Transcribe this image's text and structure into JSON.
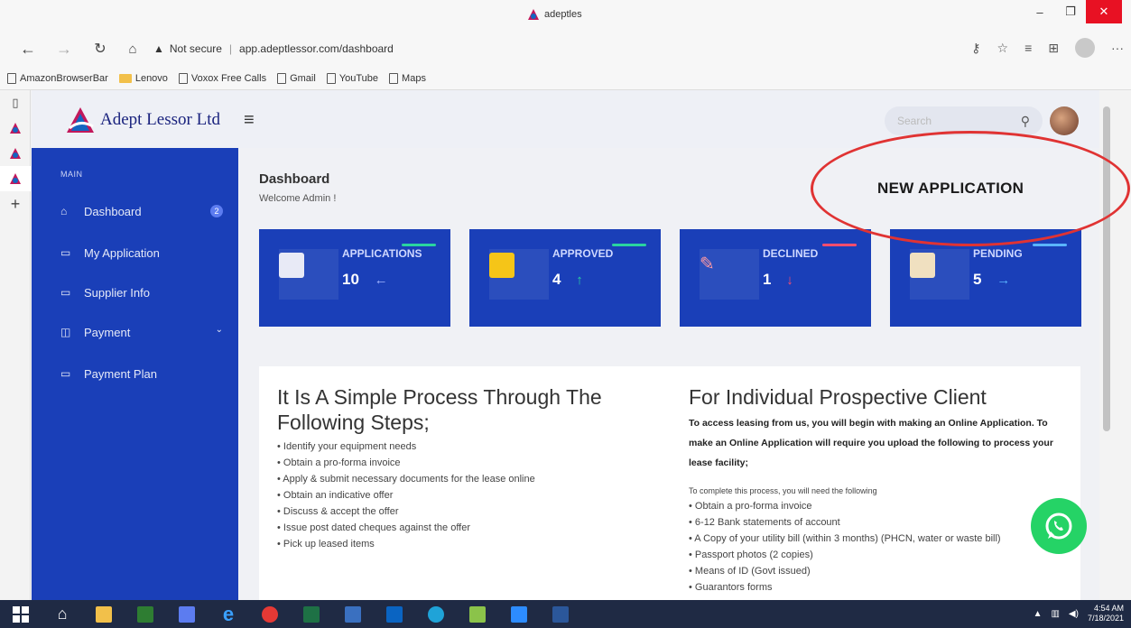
{
  "browser": {
    "tab_title": "adeptles",
    "security_label": "Not secure",
    "url": "app.adeptlessor.com/dashboard",
    "window_controls": [
      "–",
      "❐",
      "✕"
    ],
    "bookmarks": [
      {
        "label": "AmazonBrowserBar",
        "type": "page"
      },
      {
        "label": "Lenovo",
        "type": "folder"
      },
      {
        "label": "Voxox Free Calls",
        "type": "page"
      },
      {
        "label": "Gmail",
        "type": "page"
      },
      {
        "label": "YouTube",
        "type": "page"
      },
      {
        "label": "Maps",
        "type": "page"
      }
    ]
  },
  "header": {
    "brand": "Adept Lessor Ltd",
    "search_placeholder": "Search"
  },
  "sidebar": {
    "section_label": "MAIN",
    "items": [
      {
        "label": "Dashboard",
        "badge": "2"
      },
      {
        "label": "My Application"
      },
      {
        "label": "Supplier Info"
      },
      {
        "label": "Payment"
      },
      {
        "label": "Payment Plan"
      }
    ]
  },
  "main": {
    "title": "Dashboard",
    "welcome": "Welcome Admin !",
    "cards": [
      {
        "label": "APPLICATIONS",
        "value": "10",
        "arrow": "←",
        "arrow_color": "#9fb3ff",
        "accent": "#2ad4a0"
      },
      {
        "label": "APPROVED",
        "value": "4",
        "arrow": "↑",
        "arrow_color": "#2ad4a0",
        "accent": "#2ad4a0"
      },
      {
        "label": "DECLINED",
        "value": "1",
        "arrow": "↓",
        "arrow_color": "#ff4d6d",
        "accent": "#ff4d6d"
      },
      {
        "label": "PENDING",
        "value": "5",
        "arrow": "→",
        "arrow_color": "#5ab4ff",
        "accent": "#5ab4ff"
      }
    ]
  },
  "steps": {
    "heading": "It Is A Simple Process Through The Following Steps;",
    "items": [
      "• Identify your equipment needs",
      "• Obtain a pro-forma invoice",
      "• Apply & submit necessary documents for the lease online",
      "• Obtain an indicative offer",
      "• Discuss & accept the offer",
      "• Issue post dated cheques against the offer",
      "• Pick up leased items"
    ]
  },
  "individual": {
    "heading": "For Individual Prospective Client",
    "intro": "To access leasing from us, you will begin with making an Online Application. To make an Online Application will require you upload the following to process your lease facility;",
    "note": "To complete this process, you will need the following",
    "items": [
      "• Obtain a pro-forma invoice",
      "• 6-12 Bank statements of account",
      "• A Copy of your utility bill (within 3 months) (PHCN, water or waste bill)",
      "• Passport photos (2 copies)",
      "• Means of ID (Govt issued)",
      "• Guarantors forms"
    ]
  },
  "annotation": {
    "callout": "NEW APPLICATION",
    "color": "#e03333"
  },
  "taskbar": {
    "time": "4:54 AM",
    "date": "7/18/2021"
  }
}
